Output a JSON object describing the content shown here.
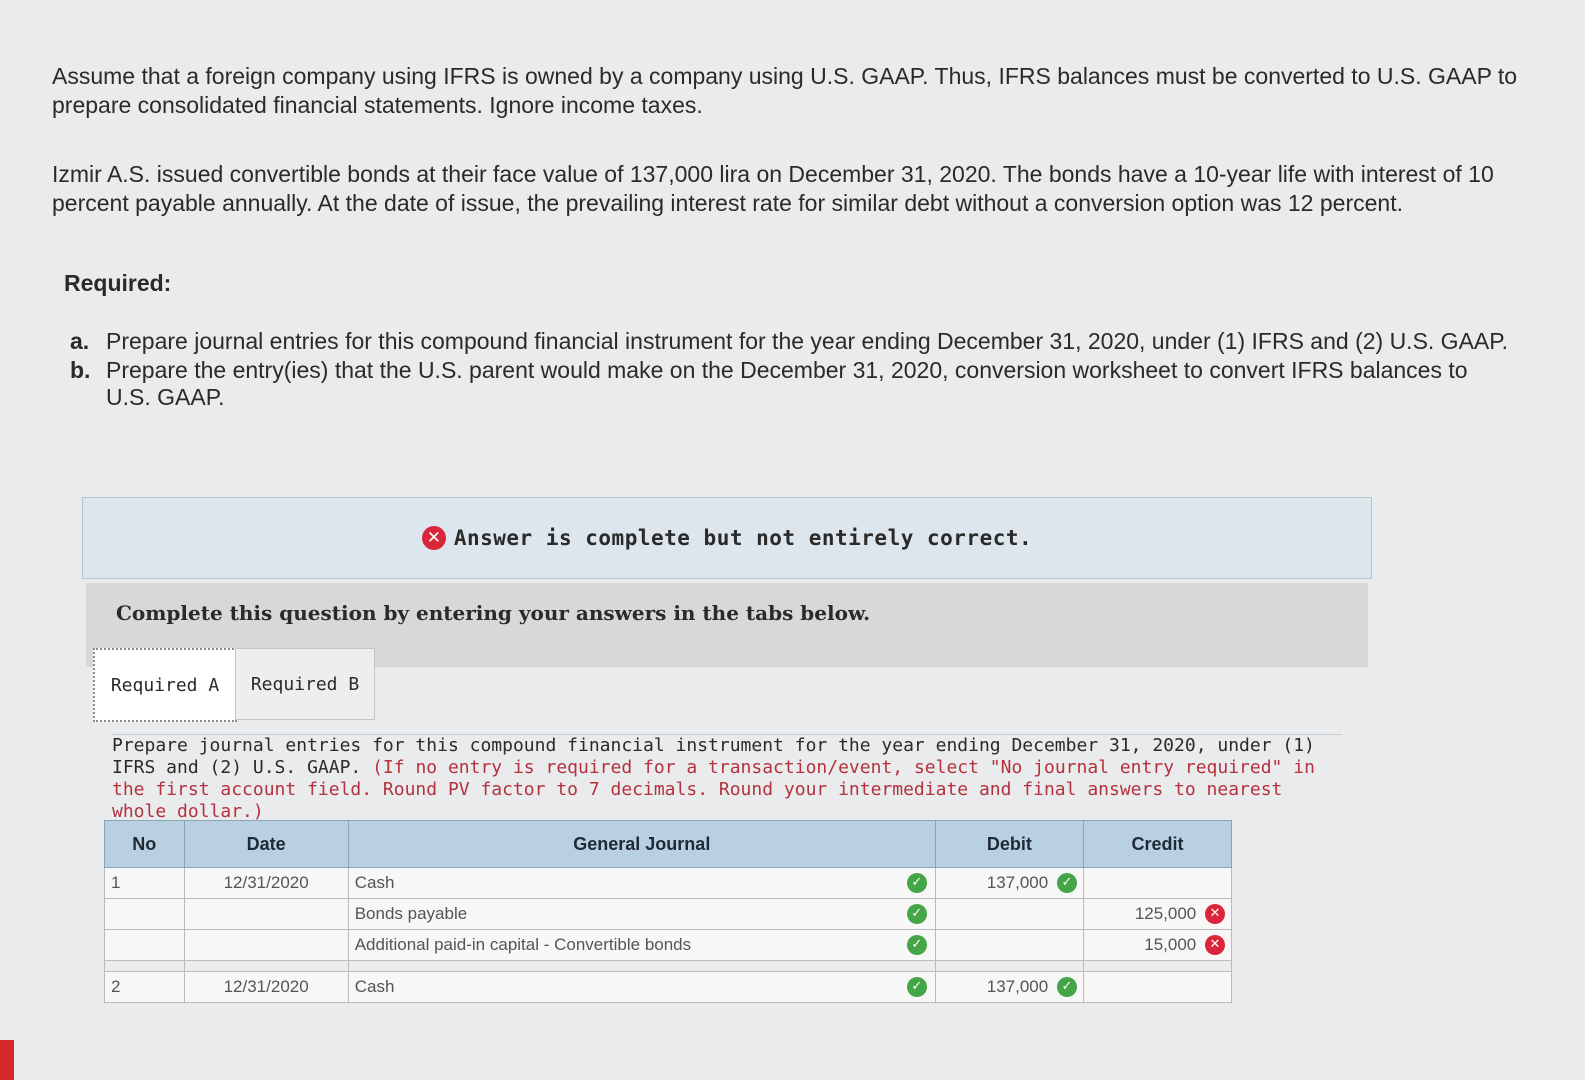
{
  "intro": {
    "p1": "Assume that a foreign company using IFRS is owned by a company using U.S. GAAP. Thus, IFRS balances must be converted to U.S. GAAP to prepare consolidated financial statements. Ignore income taxes.",
    "p2": "Izmir A.S. issued convertible bonds at their face value of 137,000 lira on December 31, 2020. The bonds have a 10-year life with interest of 10 percent payable annually. At the date of issue, the prevailing interest rate for similar debt without a conversion option was 12 percent."
  },
  "required": {
    "heading": "Required:",
    "items": [
      {
        "letter": "a.",
        "text": "Prepare journal entries for this compound financial instrument for the year ending December 31, 2020, under (1) IFRS and (2) U.S. GAAP."
      },
      {
        "letter": "b.",
        "text": "Prepare the entry(ies) that the U.S. parent would make on the December 31, 2020, conversion worksheet to convert IFRS balances to U.S. GAAP."
      }
    ]
  },
  "banner": {
    "text": "Answer is complete but not entirely correct."
  },
  "instruction": "Complete this question by entering your answers in the tabs below.",
  "tabs": [
    {
      "label": "Required A"
    },
    {
      "label": "Required B"
    }
  ],
  "question": {
    "main": "Prepare journal entries for this compound financial instrument for the year ending December 31, 2020, under (1) IFRS and (2) U.S. GAAP.",
    "note": "(If no entry is required for a transaction/event, select \"No journal entry required\" in the first account field. Round PV factor to 7 decimals. Round your intermediate and final answers to nearest whole dollar.)"
  },
  "journal": {
    "headers": {
      "no": "No",
      "date": "Date",
      "account": "General Journal",
      "debit": "Debit",
      "credit": "Credit"
    },
    "rows": [
      {
        "no": "1",
        "date": "12/31/2020",
        "account": "Cash",
        "debit": "137,000",
        "credit": ""
      },
      {
        "no": "",
        "date": "",
        "account": "Bonds payable",
        "debit": "",
        "credit": "125,000"
      },
      {
        "no": "",
        "date": "",
        "account": "Additional paid-in capital - Convertible bonds",
        "debit": "",
        "credit": "15,000"
      },
      {
        "no": "2",
        "date": "12/31/2020",
        "account": "Cash",
        "debit": "137,000",
        "credit": ""
      }
    ]
  },
  "icons": {
    "correct": "check-circle-icon",
    "incorrect": "x-circle-icon"
  },
  "colors": {
    "correct": "#44a648",
    "incorrect": "#d9263b",
    "header": "#b9cfe2"
  }
}
